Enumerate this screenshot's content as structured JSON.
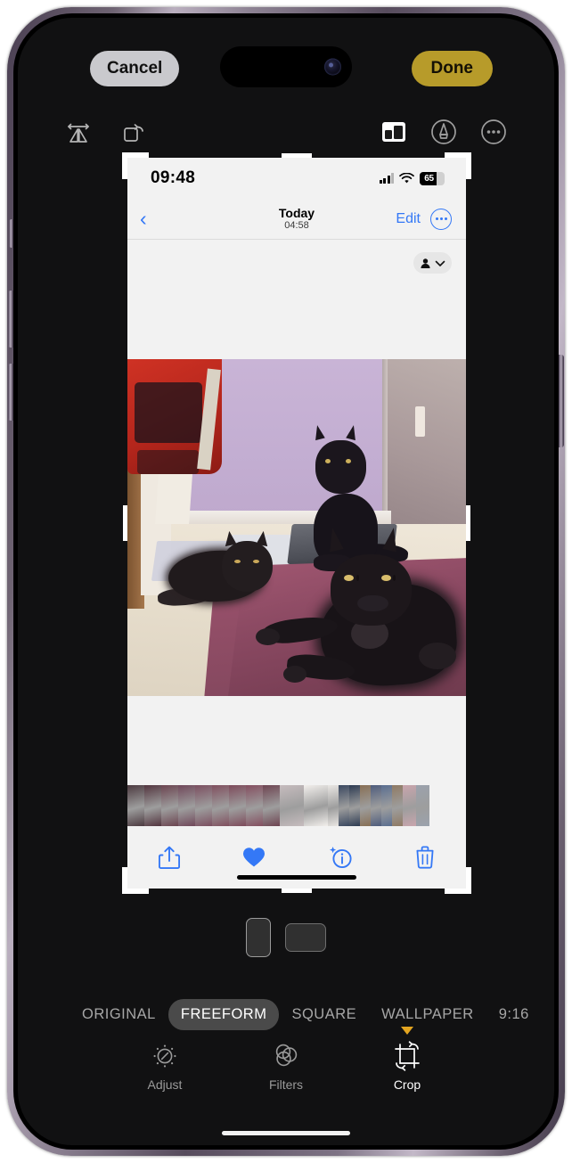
{
  "editor": {
    "cancel_label": "Cancel",
    "done_label": "Done",
    "accent_done_color": "#b79b2a",
    "tools": {
      "flip_icon": "flip-horizontal-icon",
      "rotate_icon": "rotate-left-icon",
      "aspect_icon": "aspect-ratio-icon",
      "markup_icon": "markup-pen-icon",
      "more_icon": "more-ellipsis-icon"
    },
    "orientation": {
      "portrait_label": "portrait",
      "landscape_label": "landscape",
      "selected": "portrait"
    },
    "aspect_ratios": [
      {
        "label": "ORIGINAL",
        "selected": false
      },
      {
        "label": "FREEFORM",
        "selected": true
      },
      {
        "label": "SQUARE",
        "selected": false
      },
      {
        "label": "WALLPAPER",
        "selected": false
      },
      {
        "label": "9:16",
        "selected": false
      }
    ],
    "tabs": [
      {
        "label": "Adjust",
        "icon": "adjust-dial-icon",
        "active": false
      },
      {
        "label": "Filters",
        "icon": "filters-circles-icon",
        "active": false
      },
      {
        "label": "Crop",
        "icon": "crop-rotate-icon",
        "active": true
      }
    ]
  },
  "photo": {
    "status_bar": {
      "time": "09:48",
      "battery_percent": "65",
      "signal_icon": "cellular-signal-icon",
      "wifi_icon": "wifi-icon",
      "battery_icon": "battery-icon"
    },
    "nav_bar": {
      "back_icon": "chevron-left-icon",
      "title": "Today",
      "subtitle": "04:58",
      "edit_label": "Edit",
      "more_icon": "more-ellipsis-circle-icon"
    },
    "people_badge": {
      "person_icon": "person-icon",
      "chevron_icon": "chevron-down-icon"
    },
    "actions": [
      {
        "name": "share",
        "icon": "share-up-arrow-icon",
        "color": "#3478f6"
      },
      {
        "name": "favorite",
        "icon": "heart-filled-icon",
        "color": "#3478f6"
      },
      {
        "name": "info",
        "icon": "info-sparkle-icon",
        "color": "#3478f6"
      },
      {
        "name": "delete",
        "icon": "trash-icon",
        "color": "#3478f6"
      }
    ],
    "filmstrip_thumbs": [
      "#4c3a40",
      "#53353f",
      "#6b4450",
      "#70485a",
      "#7b4f60",
      "#80505f",
      "#7d4b5b",
      "#844f60",
      "#6e4552",
      "#c6bcbe",
      "#f2efec",
      "#e9e6e3",
      "#3a4860",
      "#2d3b52",
      "#876f55",
      "#4e5c7c",
      "#5a6e90",
      "#8f7a64",
      "#c9a5ad",
      "#9ba2ad"
    ]
  }
}
